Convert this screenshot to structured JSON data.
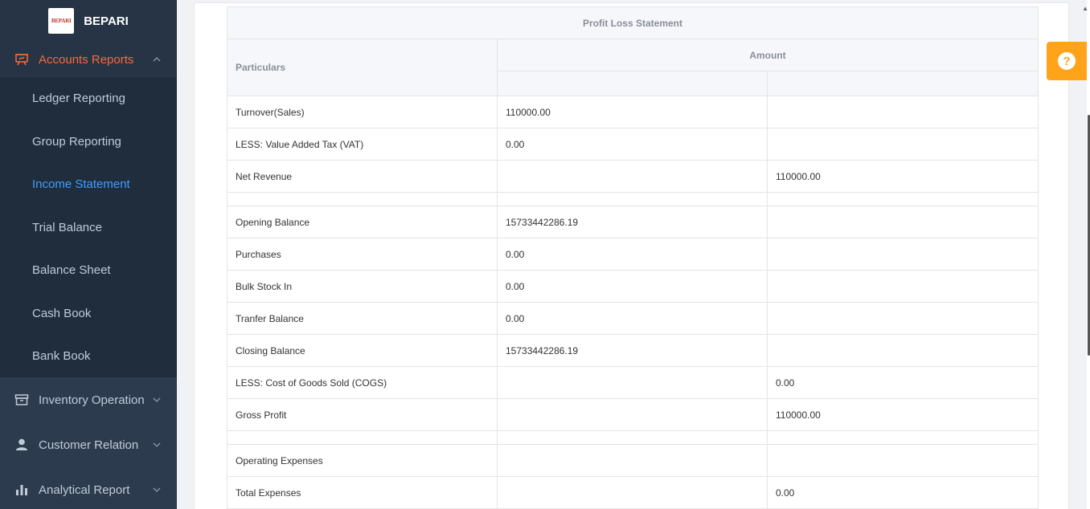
{
  "brand": {
    "logo_text": "BEPARI",
    "name": "BEPARI"
  },
  "sidebar": {
    "section_open": {
      "label": "Accounts Reports",
      "icon": "presentation-board-icon"
    },
    "sub_items": [
      {
        "label": "Ledger Reporting",
        "active": false
      },
      {
        "label": "Group Reporting",
        "active": false
      },
      {
        "label": "Income Statement",
        "active": true
      },
      {
        "label": "Trial Balance",
        "active": false
      },
      {
        "label": "Balance Sheet",
        "active": false
      },
      {
        "label": "Cash Book",
        "active": false
      },
      {
        "label": "Bank Book",
        "active": false
      }
    ],
    "sections": [
      {
        "label": "Inventory Operation",
        "icon": "archive-box-icon"
      },
      {
        "label": "Customer Relation",
        "icon": "user-icon"
      },
      {
        "label": "Analytical Report",
        "icon": "bar-chart-icon"
      }
    ],
    "colors": {
      "bg": "#1f2d3d",
      "active_section": "#f56c3b",
      "active_item": "#409eff"
    }
  },
  "statement": {
    "title": "Profit Loss Statement",
    "col_particulars": "Particulars",
    "col_amount": "Amount",
    "rows": [
      {
        "particular": "Turnover(Sales)",
        "amount1": "110000.00",
        "amount2": ""
      },
      {
        "particular": "LESS: Value Added Tax (VAT)",
        "amount1": "0.00",
        "amount2": ""
      },
      {
        "particular": "Net Revenue",
        "amount1": "",
        "amount2": "110000.00"
      },
      {
        "spacer": true
      },
      {
        "particular": "Opening Balance",
        "amount1": "15733442286.19",
        "amount2": ""
      },
      {
        "particular": "Purchases",
        "amount1": "0.00",
        "amount2": ""
      },
      {
        "particular": "Bulk Stock In",
        "amount1": "0.00",
        "amount2": ""
      },
      {
        "particular": "Tranfer Balance",
        "amount1": "0.00",
        "amount2": ""
      },
      {
        "particular": "Closing Balance",
        "amount1": "15733442286.19",
        "amount2": ""
      },
      {
        "particular": "LESS: Cost of Goods Sold (COGS)",
        "amount1": "",
        "amount2": "0.00"
      },
      {
        "particular": "Gross Profit",
        "amount1": "",
        "amount2": "110000.00"
      },
      {
        "spacer": true
      },
      {
        "particular": "Operating Expenses",
        "amount1": "",
        "amount2": ""
      },
      {
        "particular": "Total Expenses",
        "amount1": "",
        "amount2": "0.00"
      }
    ]
  },
  "help": {
    "label": "?",
    "icon": "question-circle-icon",
    "color": "#ffa31a"
  }
}
